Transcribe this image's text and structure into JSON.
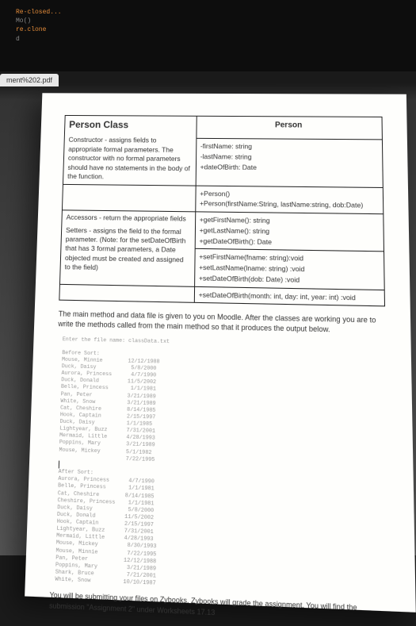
{
  "tab": {
    "filename": "ment%202.pdf"
  },
  "code_overlay": {
    "l1": "Re-closed...",
    "l2": "Mo()",
    "l3": "re.clone",
    "l4": "d"
  },
  "doc": {
    "title": "Person Class",
    "left_constructor": "Constructor - assigns fields to appropriate formal parameters. The constructor with no formal parameters should have no statements in the body of the function.",
    "left_accessors": "Accessors - return the appropriate fields",
    "left_setters": "Setters - assigns the field to the formal parameter. (Note: for the setDateOfBirth that has 3 formal parameters, a Date objected must be created and assigned to the field)",
    "class_header": "Person",
    "fields": {
      "f1": "-firstName: string",
      "f2": "-lastName: string",
      "f3": "+dateOfBirth: Date"
    },
    "ctors": {
      "c1": "+Person()",
      "c2": "+Person(firstName:String, lastName:string, dob:Date)"
    },
    "getters": {
      "g1": "+getFirstName(): string",
      "g2": "+getLastName(): string",
      "g3": "+getDateOfBirth(): Date"
    },
    "setters": {
      "s1": "+setFirstName(fname: string):void",
      "s2": "+setLastName(lname: string) :void",
      "s3": "+setDateOfBirth(dob: Date) :void"
    },
    "setters2": {
      "s4": "+setDateOfBirth(month: int, day: int, year: int) :void"
    },
    "instructions1": "The main method and data file is given to you on Moodle. After the classes are working you are to write the methods called from the main method so that it produces the output below.",
    "terminal_header": "Enter the file name: classData.txt",
    "before_sort_label": "Before Sort:",
    "after_sort_label": "After Sort:",
    "rows_before": [
      "Mouse, Minnie        12/12/1988",
      "Duck, Daisy           5/8/2000",
      "Aurora, Princess      4/7/1990",
      "Duck, Donald         11/5/2002",
      "Belle, Princess       1/1/1981",
      "Pan, Peter           3/21/1989",
      "White, Snow          3/21/1989",
      "Cat, Cheshire        8/14/1985",
      "Hook, Captain        2/15/1997",
      "Duck, Daisy          1/1/1985",
      "Lightyear, Buzz      7/31/2001",
      "Mermaid, Little      4/28/1993",
      "Poppins, Mary        3/21/1989",
      "Mouse, Mickey        5/1/1982",
      "                     7/22/1995"
    ],
    "rows_after": [
      "Aurora, Princess      4/7/1990",
      "Belle, Princess       1/1/1981",
      "Cat, Cheshire        8/14/1985",
      "Cheshire, Princess    1/1/1981",
      "Duck, Daisy           5/8/2000",
      "Duck, Donald         11/5/2002",
      "Hook, Captain        2/15/1997",
      "Lightyear, Buzz      7/31/2001",
      "Mermaid, Little      4/28/1993",
      "Mouse, Mickey         8/30/1993",
      "Mouse, Minnie         7/22/1995",
      "Pan, Peter           12/12/1988",
      "Poppins, Mary         3/21/1989",
      "Shark, Bruce          7/21/2001",
      "White, Snow          10/10/1987"
    ],
    "instructions2": "You will be submitting your files on Zybooks. Zybooks will grade the assignment. You will find the submission \"Assignment 2\" under Worksheets 17.13"
  }
}
